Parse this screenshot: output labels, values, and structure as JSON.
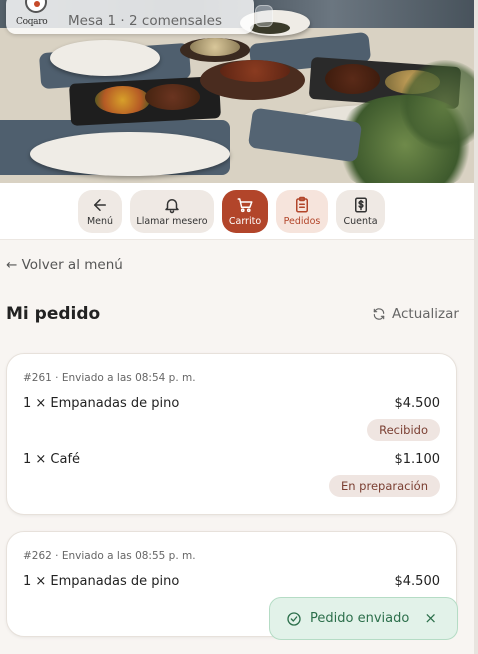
{
  "header": {
    "logo_text": "Coqaro",
    "table_info": "Mesa 1 · 2 comensales"
  },
  "nav": {
    "items": [
      {
        "label": "Menú",
        "icon": "arrow-left-icon"
      },
      {
        "label": "Llamar mesero",
        "icon": "bell-icon"
      },
      {
        "label": "Carrito",
        "icon": "cart-icon"
      },
      {
        "label": "Pedidos",
        "icon": "clipboard-icon"
      },
      {
        "label": "Cuenta",
        "icon": "dollar-receipt-icon"
      }
    ],
    "active_color": "#b2452a"
  },
  "back_link": "← Volver al menú",
  "page_title": "Mi pedido",
  "refresh_label": "Actualizar",
  "orders": [
    {
      "meta": "#261 · Enviado a las 08:54 p. m.",
      "items": [
        {
          "desc": "1 × Empanadas de pino",
          "price": "$4.500",
          "status": "Recibido"
        },
        {
          "desc": "1 × Café",
          "price": "$1.100",
          "status": "En preparación"
        }
      ]
    },
    {
      "meta": "#262 · Enviado a las 08:55 p. m.",
      "items": [
        {
          "desc": "1 × Empanadas de pino",
          "price": "$4.500"
        }
      ]
    }
  ],
  "toast": {
    "message": "Pedido enviado",
    "close": "×",
    "color": "#2c6f4b"
  }
}
